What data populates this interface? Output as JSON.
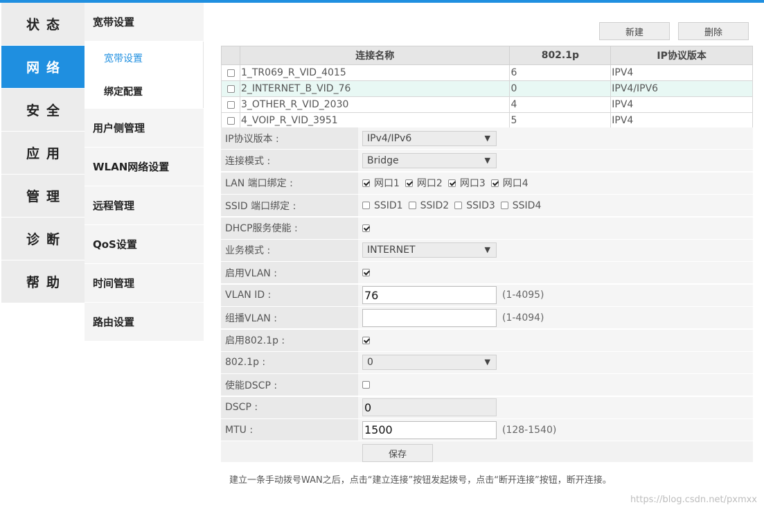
{
  "main_nav": [
    {
      "label": "状态",
      "active": false
    },
    {
      "label": "网络",
      "active": true
    },
    {
      "label": "安全",
      "active": false
    },
    {
      "label": "应用",
      "active": false
    },
    {
      "label": "管理",
      "active": false
    },
    {
      "label": "诊断",
      "active": false
    },
    {
      "label": "帮助",
      "active": false
    }
  ],
  "sub_nav": {
    "broadband": {
      "label": "宽带设置",
      "children": [
        {
          "label": "宽带设置",
          "active": true
        },
        {
          "label": "绑定配置",
          "active": false
        }
      ]
    },
    "items": [
      "用户侧管理",
      "WLAN网络设置",
      "远程管理",
      "QoS设置",
      "时间管理",
      "路由设置"
    ]
  },
  "toolbar": {
    "new_label": "新建",
    "delete_label": "删除"
  },
  "table": {
    "headers": [
      "连接名称",
      "802.1p",
      "IP协议版本"
    ],
    "rows": [
      {
        "name": "1_TR069_R_VID_4015",
        "p": "6",
        "ip": "IPV4",
        "selected": false
      },
      {
        "name": "2_INTERNET_B_VID_76",
        "p": "0",
        "ip": "IPV4/IPV6",
        "selected": true
      },
      {
        "name": "3_OTHER_R_VID_2030",
        "p": "4",
        "ip": "IPV4",
        "selected": false
      },
      {
        "name": "4_VOIP_R_VID_3951",
        "p": "5",
        "ip": "IPV4",
        "selected": false
      }
    ]
  },
  "form": {
    "ip_version": {
      "label": "IP协议版本 :",
      "value": "IPv4/IPv6"
    },
    "conn_mode": {
      "label": "连接模式 :",
      "value": "Bridge"
    },
    "lan_bind": {
      "label": "LAN 端口绑定 :",
      "ports": [
        {
          "label": "网口1",
          "checked": true
        },
        {
          "label": "网口2",
          "checked": true
        },
        {
          "label": "网口3",
          "checked": true
        },
        {
          "label": "网口4",
          "checked": true
        }
      ]
    },
    "ssid_bind": {
      "label": "SSID 端口绑定 :",
      "ssids": [
        {
          "label": "SSID1",
          "checked": false
        },
        {
          "label": "SSID2",
          "checked": false
        },
        {
          "label": "SSID3",
          "checked": false
        },
        {
          "label": "SSID4",
          "checked": false
        }
      ]
    },
    "dhcp": {
      "label": "DHCP服务使能 :",
      "checked": true
    },
    "service_mode": {
      "label": "业务模式 :",
      "value": "INTERNET"
    },
    "enable_vlan": {
      "label": "启用VLAN :",
      "checked": true
    },
    "vlan_id": {
      "label": "VLAN ID :",
      "value": "76",
      "hint": "(1-4095)"
    },
    "multicast_vlan": {
      "label": "组播VLAN :",
      "value": "",
      "hint": "(1-4094)"
    },
    "enable_8021p": {
      "label": "启用802.1p :",
      "checked": true
    },
    "p8021": {
      "label": "802.1p :",
      "value": "0"
    },
    "enable_dscp": {
      "label": "使能DSCP :",
      "checked": false
    },
    "dscp": {
      "label": "DSCP :",
      "value": "0"
    },
    "mtu": {
      "label": "MTU :",
      "value": "1500",
      "hint": "(128-1540)"
    },
    "save_label": "保存"
  },
  "note": "建立一条手动拨号WAN之后，点击“建立连接”按钮发起拨号，点击“断开连接”按钮，断开连接。",
  "watermark": "https://blog.csdn.net/pxmxx",
  "colors": {
    "accent": "#1f8fe0",
    "selected_row": "#e8f8f4"
  }
}
